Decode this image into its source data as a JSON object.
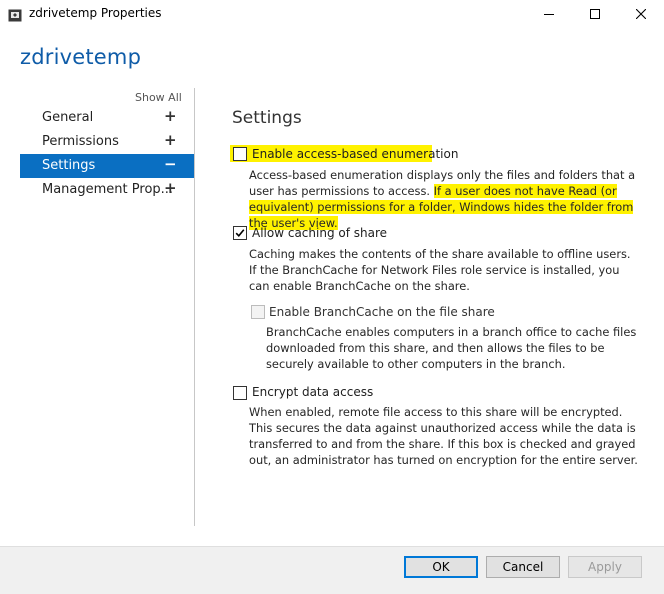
{
  "window": {
    "title": "zdrivetemp Properties",
    "icon": "share-folder-icon",
    "controls": [
      "minimize-icon",
      "maximize-icon",
      "close-icon"
    ]
  },
  "header": {
    "title": "zdrivetemp"
  },
  "sidebar": {
    "show_all": "Show All",
    "items": [
      {
        "label": "General",
        "sign": "+",
        "selected": false
      },
      {
        "label": "Permissions",
        "sign": "+",
        "selected": false
      },
      {
        "label": "Settings",
        "sign": "−",
        "selected": true
      },
      {
        "label": "Management Prop...",
        "sign": "+",
        "selected": false
      }
    ],
    "selected_color": "#0a6fc2"
  },
  "settings": {
    "heading": "Settings",
    "abe": {
      "label": "Enable access-based enumeration",
      "checked": false,
      "desc_part1": "Access-based enumeration displays only the files and folders that a user has permissions to access.",
      "desc_part2": "If a user does not have Read (or equivalent) permissions for a folder, Windows hides the folder from the user's view."
    },
    "caching": {
      "label": "Allow caching of share",
      "checked": true,
      "desc": "Caching makes the contents of the share available to offline users. If the BranchCache for Network Files role service is installed, you can enable BranchCache on the share."
    },
    "branchcache": {
      "label": "Enable BranchCache on the file share",
      "checked": false,
      "enabled": false,
      "desc": "BranchCache enables computers in a branch office to cache files downloaded from this share, and then allows the files to be securely available to other computers in the branch."
    },
    "encrypt": {
      "label": "Encrypt data access",
      "checked": false,
      "desc": "When enabled, remote file access to this share will be encrypted. This secures the data against unauthorized access while the data is transferred to and from the share. If this box is checked and grayed out, an administrator has turned on encryption for the entire server."
    },
    "highlight_color": "#fff200"
  },
  "footer": {
    "ok": "OK",
    "cancel": "Cancel",
    "apply": "Apply"
  }
}
